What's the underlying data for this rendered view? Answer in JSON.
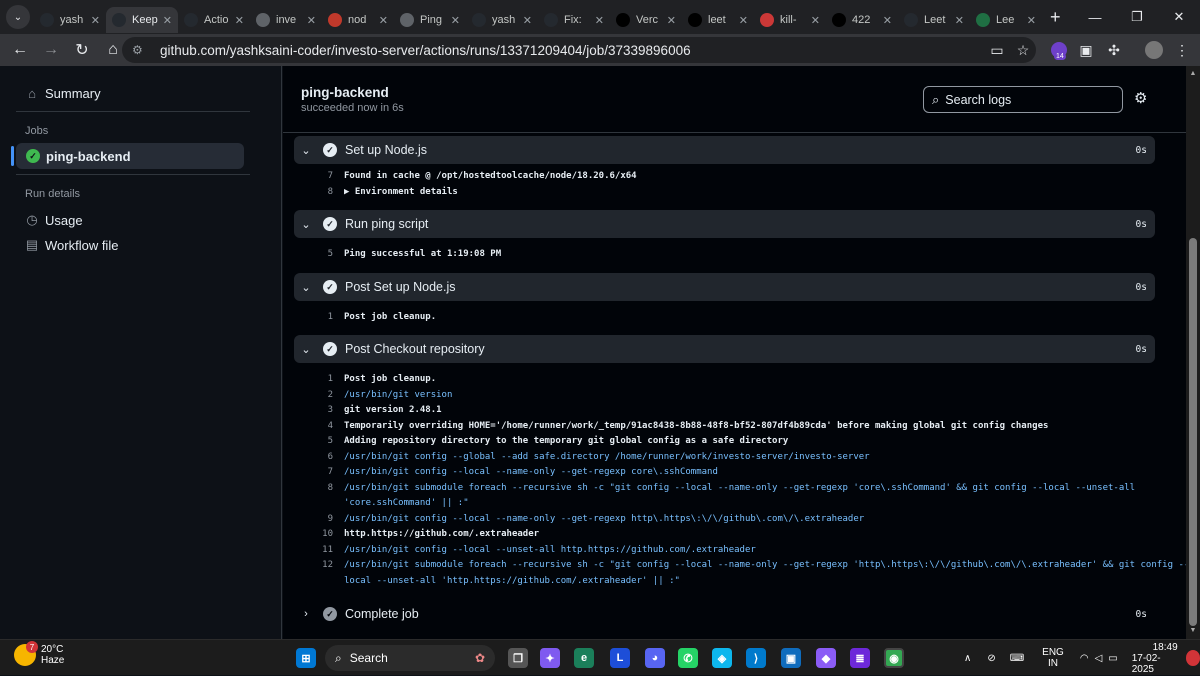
{
  "browser": {
    "tabs": [
      {
        "title": "yash",
        "icon": "github-icon",
        "color": "#24292f"
      },
      {
        "title": "Keep",
        "icon": "github-icon",
        "color": "#24292f",
        "active": true
      },
      {
        "title": "Actio",
        "icon": "github-icon",
        "color": "#24292f"
      },
      {
        "title": "inve",
        "icon": "globe-icon",
        "color": "#5f6368"
      },
      {
        "title": "nod",
        "icon": "node-icon",
        "color": "#c0392b"
      },
      {
        "title": "Ping",
        "icon": "ping-icon",
        "color": "#5f6368"
      },
      {
        "title": "yash",
        "icon": "github-icon",
        "color": "#24292f"
      },
      {
        "title": "Fix:",
        "icon": "github-icon",
        "color": "#24292f"
      },
      {
        "title": "Verc",
        "icon": "vercel-icon",
        "color": "#000000"
      },
      {
        "title": "leet",
        "icon": "vercel-icon",
        "color": "#000000"
      },
      {
        "title": "kill-",
        "icon": "npm-icon",
        "color": "#cb3837"
      },
      {
        "title": "422",
        "icon": "medium-icon",
        "color": "#000000"
      },
      {
        "title": "Leet",
        "icon": "github-icon",
        "color": "#24292f"
      },
      {
        "title": "Lee",
        "icon": "s-icon",
        "color": "#1f6f43"
      }
    ],
    "url": "github.com/yashksaini-coder/investo-server/actions/runs/13371209404/job/37339896006",
    "extension_badge": "14"
  },
  "sidebar": {
    "summary": "Summary",
    "jobs_heading": "Jobs",
    "active_job": "ping-backend",
    "run_details_heading": "Run details",
    "usage": "Usage",
    "workflow_file": "Workflow file"
  },
  "job": {
    "title": "ping-backend",
    "subtitle": "succeeded now in 6s",
    "search_placeholder": "Search logs"
  },
  "steps": [
    {
      "name": "Set up Node.js",
      "duration": "0s",
      "lines": [
        {
          "n": "7",
          "t": "Found in cache @ /opt/hostedtoolcache/node/18.20.6/x64",
          "cmd": false
        },
        {
          "n": "8",
          "t": "▶ Environment details",
          "cmd": false
        }
      ]
    },
    {
      "name": "Run ping script",
      "duration": "0s",
      "lines": [
        {
          "n": "5",
          "t": "Ping successful at 1:19:08 PM",
          "cmd": false
        }
      ]
    },
    {
      "name": "Post Set up Node.js",
      "duration": "0s",
      "lines": [
        {
          "n": "1",
          "t": "Post job cleanup.",
          "cmd": false
        }
      ]
    },
    {
      "name": "Post Checkout repository",
      "duration": "0s",
      "lines": [
        {
          "n": "1",
          "t": "Post job cleanup.",
          "cmd": false
        },
        {
          "n": "2",
          "t": "/usr/bin/git version",
          "cmd": true
        },
        {
          "n": "3",
          "t": "git version 2.48.1",
          "cmd": false
        },
        {
          "n": "4",
          "t": "Temporarily overriding HOME='/home/runner/work/_temp/91ac8438-8b88-48f8-bf52-807df4b89cda' before making global git config changes",
          "cmd": false
        },
        {
          "n": "5",
          "t": "Adding repository directory to the temporary git global config as a safe directory",
          "cmd": false
        },
        {
          "n": "6",
          "t": "/usr/bin/git config --global --add safe.directory /home/runner/work/investo-server/investo-server",
          "cmd": true
        },
        {
          "n": "7",
          "t": "/usr/bin/git config --local --name-only --get-regexp core\\.sshCommand",
          "cmd": true
        },
        {
          "n": "8",
          "t": "/usr/bin/git submodule foreach --recursive sh -c \"git config --local --name-only --get-regexp 'core\\.sshCommand' && git config --local --unset-all",
          "cmd": true
        },
        {
          "n": "",
          "t": "'core.sshCommand' || :\"",
          "cmd": true
        },
        {
          "n": "9",
          "t": "/usr/bin/git config --local --name-only --get-regexp http\\.https\\:\\/\\/github\\.com\\/\\.extraheader",
          "cmd": true
        },
        {
          "n": "10",
          "t": "http.https://github.com/.extraheader",
          "cmd": false
        },
        {
          "n": "11",
          "t": "/usr/bin/git config --local --unset-all http.https://github.com/.extraheader",
          "cmd": true
        },
        {
          "n": "12",
          "t": "/usr/bin/git submodule foreach --recursive sh -c \"git config --local --name-only --get-regexp 'http\\.https\\:\\/\\/github\\.com\\/\\.extraheader' && git config --",
          "cmd": true
        },
        {
          "n": "",
          "t": "local --unset-all 'http.https://github.com/.extraheader' || :\"",
          "cmd": true
        }
      ]
    },
    {
      "name": "Complete job",
      "duration": "0s",
      "lines": []
    }
  ],
  "taskbar": {
    "weather_temp": "20°C",
    "weather_desc": "Haze",
    "weather_badge": "7",
    "search_label": "Search",
    "lang_top": "ENG",
    "lang_bottom": "IN",
    "time": "18:49",
    "date": "17-02-2025"
  }
}
